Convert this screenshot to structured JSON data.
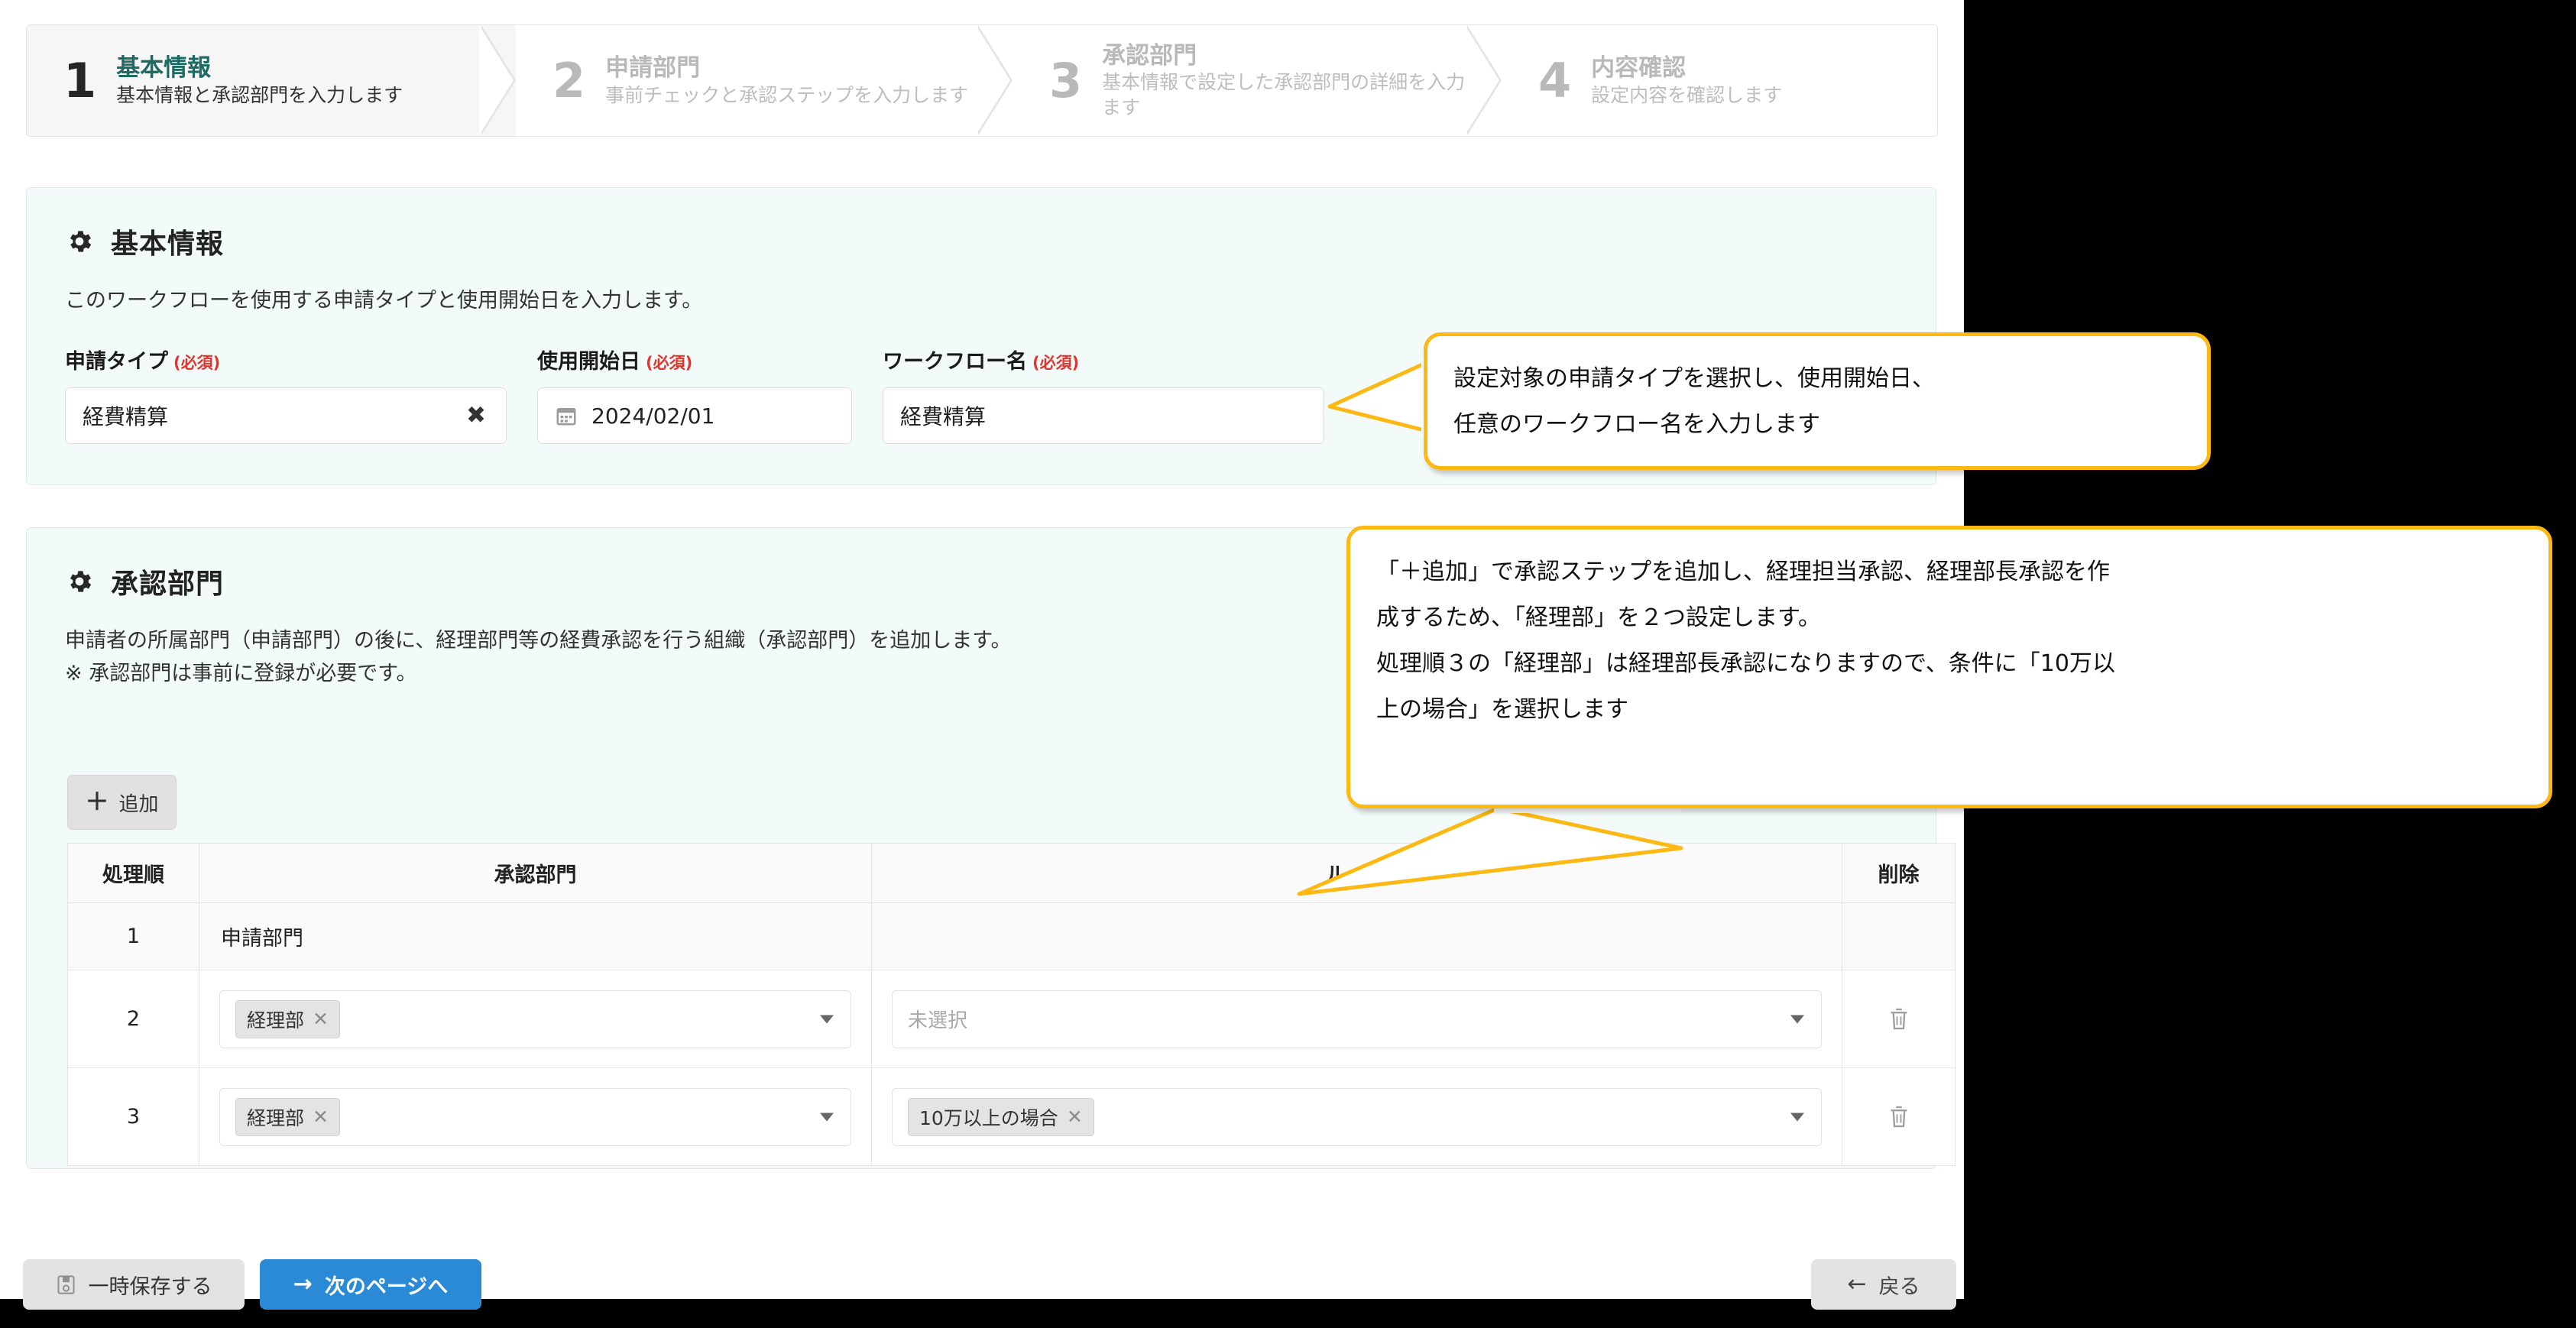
{
  "stepper": {
    "steps": [
      {
        "num": "1",
        "title": "基本情報",
        "desc": "基本情報と承認部門を入力します"
      },
      {
        "num": "2",
        "title": "申請部門",
        "desc": "事前チェックと承認ステップを入力します"
      },
      {
        "num": "3",
        "title": "承認部門",
        "desc": "基本情報で設定した承認部門の詳細を入力します"
      },
      {
        "num": "4",
        "title": "内容確認",
        "desc": "設定内容を確認します"
      }
    ]
  },
  "basic": {
    "icon": "gear-icon",
    "title": "基本情報",
    "description": "このワークフローを使用する申請タイプと使用開始日を入力します。",
    "fields": [
      {
        "label": "申請タイプ",
        "required": "(必須)",
        "value": "経費精算",
        "clear": "✖"
      },
      {
        "label": "使用開始日",
        "required": "(必須)",
        "value": "2024/02/01",
        "icon": "calendar-icon"
      },
      {
        "label": "ワークフロー名",
        "required": "(必須)",
        "value": "経費精算"
      }
    ]
  },
  "approval": {
    "icon": "gear-icon",
    "title": "承認部門",
    "description_line1": "申請者の所属部門（申請部門）の後に、経理部門等の経費承認を行う組織（承認部門）を追加します。",
    "description_line2": "※ 承認部門は事前に登録が必要です。",
    "add_button": {
      "plus": "＋",
      "label": "追加"
    },
    "table": {
      "headers": [
        "処理順",
        "承認部門",
        "ルール",
        "削除"
      ],
      "rows": [
        {
          "order": "1",
          "dept_text": "申請部門",
          "dept_tag": null,
          "rule_tag": null,
          "rule_placeholder": null,
          "delete": false
        },
        {
          "order": "2",
          "dept_text": null,
          "dept_tag": "経理部",
          "rule_tag": null,
          "rule_placeholder": "未選択",
          "delete": true
        },
        {
          "order": "3",
          "dept_text": null,
          "dept_tag": "経理部",
          "rule_tag": "10万以上の場合",
          "rule_placeholder": null,
          "delete": true
        }
      ],
      "tag_remove": "✕",
      "delete_icon": "trash-icon"
    }
  },
  "callouts": [
    {
      "id": "callout-basic-info",
      "line1": "設定対象の申請タイプを選択し、使用開始日、",
      "line2": "任意のワークフロー名を入力します"
    },
    {
      "id": "callout-approval-steps",
      "line1": "「＋追加」で承認ステップを追加し、経理担当承認、経理部長承認を作",
      "line2": "成するため、「経理部」を２つ設定します。",
      "line3": "処理順３の「経理部」は経理部長承認になりますので、条件に「10万以",
      "line4": "上の場合」を選択します"
    }
  ],
  "footer": {
    "save": {
      "icon": "save-icon",
      "label": "一時保存する"
    },
    "next": {
      "icon": "arrow-right-icon",
      "label": "次のページへ"
    },
    "back": {
      "icon": "arrow-left-icon",
      "label": "戻る"
    }
  },
  "colors": {
    "accent_yellow": "#fcb813",
    "primary_blue": "#2b8ad6",
    "active_step": "#1d6b63",
    "required_red": "#e2342c",
    "panel_bg": "#f3fbfa"
  }
}
